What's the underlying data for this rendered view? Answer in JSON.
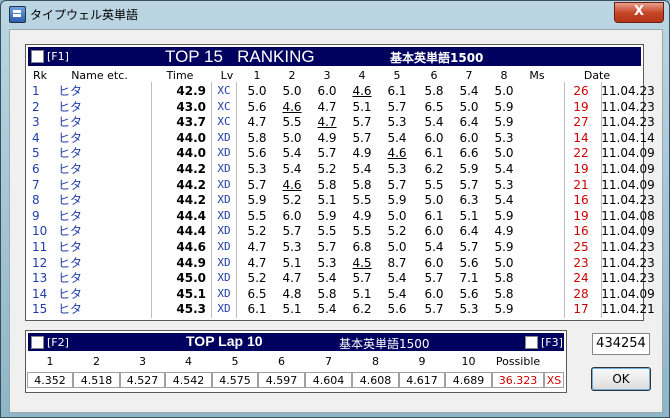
{
  "window": {
    "title": "タイプウェル英単語",
    "close": "X"
  },
  "ranking": {
    "fkey": "[F1]",
    "title": "TOP 15   RANKING",
    "subtitle": "基本英単語1500",
    "headers": [
      "Rk",
      "Name etc.",
      "Time",
      "Lv",
      "1",
      "2",
      "3",
      "4",
      "5",
      "6",
      "7",
      "8",
      "Ms",
      "Date"
    ],
    "rows": [
      {
        "rk": "1",
        "name": "ヒタ",
        "time": "42.9",
        "lv": "XC",
        "laps": [
          "5.0",
          "5.0",
          "6.0",
          "4.6",
          "6.1",
          "5.8",
          "5.4",
          "5.0"
        ],
        "ms": "26",
        "date": "11.04.23"
      },
      {
        "rk": "2",
        "name": "ヒタ",
        "time": "43.0",
        "lv": "XC",
        "laps": [
          "5.6",
          "4.6",
          "4.7",
          "5.1",
          "5.7",
          "6.5",
          "5.0",
          "5.9"
        ],
        "ms": "19",
        "date": "11.04.23"
      },
      {
        "rk": "3",
        "name": "ヒタ",
        "time": "43.7",
        "lv": "XC",
        "laps": [
          "4.7",
          "5.5",
          "4.7",
          "5.7",
          "5.3",
          "5.4",
          "6.4",
          "5.9"
        ],
        "ms": "27",
        "date": "11.04.23"
      },
      {
        "rk": "4",
        "name": "ヒタ",
        "time": "44.0",
        "lv": "XD",
        "laps": [
          "5.8",
          "5.0",
          "4.9",
          "5.7",
          "5.4",
          "6.0",
          "6.0",
          "5.3"
        ],
        "ms": "14",
        "date": "11.04.14"
      },
      {
        "rk": "5",
        "name": "ヒタ",
        "time": "44.0",
        "lv": "XD",
        "laps": [
          "5.6",
          "5.4",
          "5.7",
          "4.9",
          "4.6",
          "6.1",
          "6.6",
          "5.0"
        ],
        "ms": "22",
        "date": "11.04.09"
      },
      {
        "rk": "6",
        "name": "ヒタ",
        "time": "44.2",
        "lv": "XD",
        "laps": [
          "5.3",
          "5.4",
          "5.2",
          "5.4",
          "5.3",
          "6.2",
          "5.9",
          "5.4"
        ],
        "ms": "19",
        "date": "11.04.09"
      },
      {
        "rk": "7",
        "name": "ヒタ",
        "time": "44.2",
        "lv": "XD",
        "laps": [
          "5.7",
          "4.6",
          "5.8",
          "5.8",
          "5.7",
          "5.5",
          "5.7",
          "5.3"
        ],
        "ms": "21",
        "date": "11.04.09"
      },
      {
        "rk": "8",
        "name": "ヒタ",
        "time": "44.2",
        "lv": "XD",
        "laps": [
          "5.9",
          "5.2",
          "5.1",
          "5.5",
          "5.9",
          "5.0",
          "6.3",
          "5.4"
        ],
        "ms": "16",
        "date": "11.04.23"
      },
      {
        "rk": "9",
        "name": "ヒタ",
        "time": "44.4",
        "lv": "XD",
        "laps": [
          "5.5",
          "6.0",
          "5.9",
          "4.9",
          "5.0",
          "6.1",
          "5.1",
          "5.9"
        ],
        "ms": "19",
        "date": "11.04.08"
      },
      {
        "rk": "10",
        "name": "ヒタ",
        "time": "44.4",
        "lv": "XD",
        "laps": [
          "5.2",
          "5.7",
          "5.5",
          "5.5",
          "5.2",
          "6.0",
          "6.4",
          "4.9"
        ],
        "ms": "16",
        "date": "11.04.09"
      },
      {
        "rk": "11",
        "name": "ヒタ",
        "time": "44.6",
        "lv": "XD",
        "laps": [
          "4.7",
          "5.3",
          "5.7",
          "6.8",
          "5.0",
          "5.4",
          "5.7",
          "5.9"
        ],
        "ms": "25",
        "date": "11.04.23"
      },
      {
        "rk": "12",
        "name": "ヒタ",
        "time": "44.9",
        "lv": "XD",
        "laps": [
          "4.7",
          "5.1",
          "5.3",
          "4.5",
          "8.7",
          "6.0",
          "5.6",
          "5.0"
        ],
        "ms": "23",
        "date": "11.04.23"
      },
      {
        "rk": "13",
        "name": "ヒタ",
        "time": "45.0",
        "lv": "XD",
        "laps": [
          "5.2",
          "4.7",
          "5.4",
          "5.7",
          "5.4",
          "5.7",
          "7.1",
          "5.8"
        ],
        "ms": "24",
        "date": "11.04.23"
      },
      {
        "rk": "14",
        "name": "ヒタ",
        "time": "45.1",
        "lv": "XD",
        "laps": [
          "6.5",
          "4.8",
          "5.8",
          "5.1",
          "5.4",
          "6.0",
          "5.6",
          "5.8"
        ],
        "ms": "28",
        "date": "11.04.09"
      },
      {
        "rk": "15",
        "name": "ヒタ",
        "time": "45.3",
        "lv": "XD",
        "laps": [
          "6.1",
          "5.1",
          "5.4",
          "6.2",
          "5.6",
          "5.7",
          "5.3",
          "5.9"
        ],
        "ms": "17",
        "date": "11.04.21"
      }
    ],
    "underlined": [
      [
        0,
        3
      ],
      [
        1,
        1
      ],
      [
        2,
        2
      ],
      [
        4,
        4
      ],
      [
        6,
        1
      ],
      [
        11,
        3
      ]
    ]
  },
  "lap": {
    "fkey_left": "[F2]",
    "title": "TOP Lap 10",
    "subtitle": "基本英単語1500",
    "fkey_right": "[F3]",
    "headers": [
      "1",
      "2",
      "3",
      "4",
      "5",
      "6",
      "7",
      "8",
      "9",
      "10",
      "Possible"
    ],
    "values": [
      "4.352",
      "4.518",
      "4.527",
      "4.542",
      "4.575",
      "4.597",
      "4.604",
      "4.608",
      "4.617",
      "4.689",
      "36.323"
    ],
    "possible_level": "XS"
  },
  "score": "434254",
  "ok_label": "OK"
}
